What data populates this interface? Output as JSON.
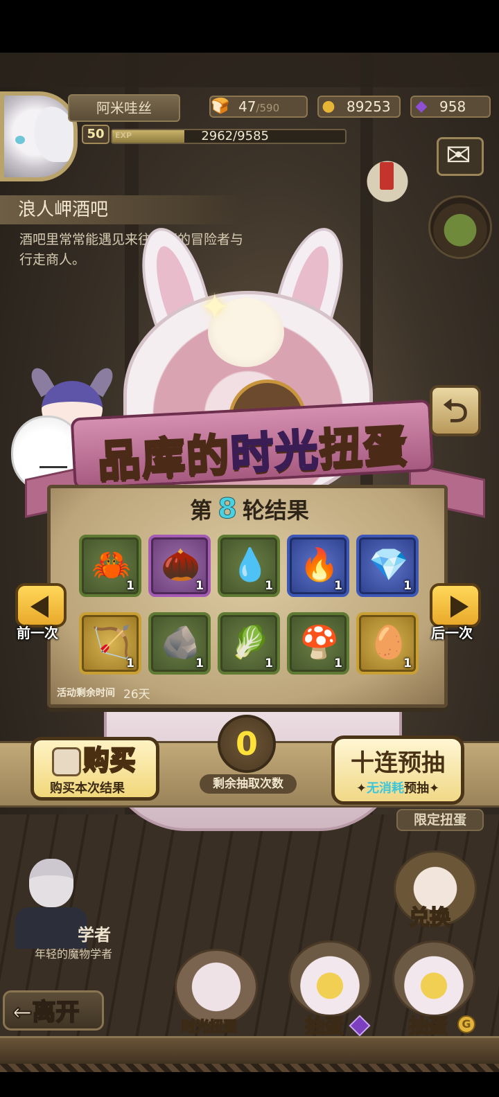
{
  "player": {
    "name": "阿米哇丝",
    "level": "50",
    "exp_tag": "EXP",
    "exp": "2962/9585",
    "exp_ratio": 0.309
  },
  "resources": {
    "stamina": "47",
    "stamina_max": "/590",
    "gold": "89253",
    "gems": "958"
  },
  "location": {
    "title": "浪人岬酒吧",
    "description": "酒吧里常常能遇见来往此区的冒险者与行走商人。"
  },
  "event": {
    "banner_part1": "品库的",
    "banner_highlight": "时光",
    "banner_part2": "扭蛋",
    "round_prefix": "第",
    "round_number": "8",
    "round_suffix": "轮结果",
    "time_left_label": "活动剩余时间",
    "time_left_value": "26天"
  },
  "results": [
    {
      "item_icon": "crab-icon",
      "glyph": "🦀",
      "rarity": "green",
      "qty": "1"
    },
    {
      "item_icon": "nut-icon",
      "glyph": "🌰",
      "rarity": "purple",
      "qty": "1"
    },
    {
      "item_icon": "potion-icon",
      "glyph": "💧",
      "rarity": "green",
      "qty": "1"
    },
    {
      "item_icon": "flame-icon",
      "glyph": "🔥",
      "rarity": "blue",
      "qty": "1"
    },
    {
      "item_icon": "crystal-icon",
      "glyph": "💎",
      "rarity": "blue",
      "qty": "1"
    },
    {
      "item_icon": "crossbow-icon",
      "glyph": "🏹",
      "rarity": "gold",
      "qty": "1"
    },
    {
      "item_icon": "stone-icon",
      "glyph": "🪨",
      "rarity": "green",
      "qty": "1"
    },
    {
      "item_icon": "radish-icon",
      "glyph": "🥬",
      "rarity": "green",
      "qty": "1"
    },
    {
      "item_icon": "mushroom-icon",
      "glyph": "🍄",
      "rarity": "green",
      "qty": "1"
    },
    {
      "item_icon": "egg-wreath-icon",
      "glyph": "🥚",
      "rarity": "gold",
      "qty": "1"
    }
  ],
  "nav": {
    "prev_label": "前一次",
    "next_label": "后一次"
  },
  "actions": {
    "buy_title": "购买",
    "buy_sub": "购买本次结果",
    "remaining_count": "0",
    "remaining_label": "剩余抽取次数",
    "ten_title": "十连预抽",
    "ten_sub_free": "无消耗",
    "ten_sub_rest": "预抽"
  },
  "side": {
    "limited_label": "限定扭蛋",
    "exchange_label": "兑换"
  },
  "npc": {
    "name": "学者",
    "description": "年轻的魔物学者"
  },
  "bottom": {
    "leave_label": "←离开",
    "time_gacha_label": "时光扭蛋",
    "gacha_gem_label": "抽蛋",
    "gacha_gold_label": "抽蛋",
    "coin_glyph": "G"
  }
}
